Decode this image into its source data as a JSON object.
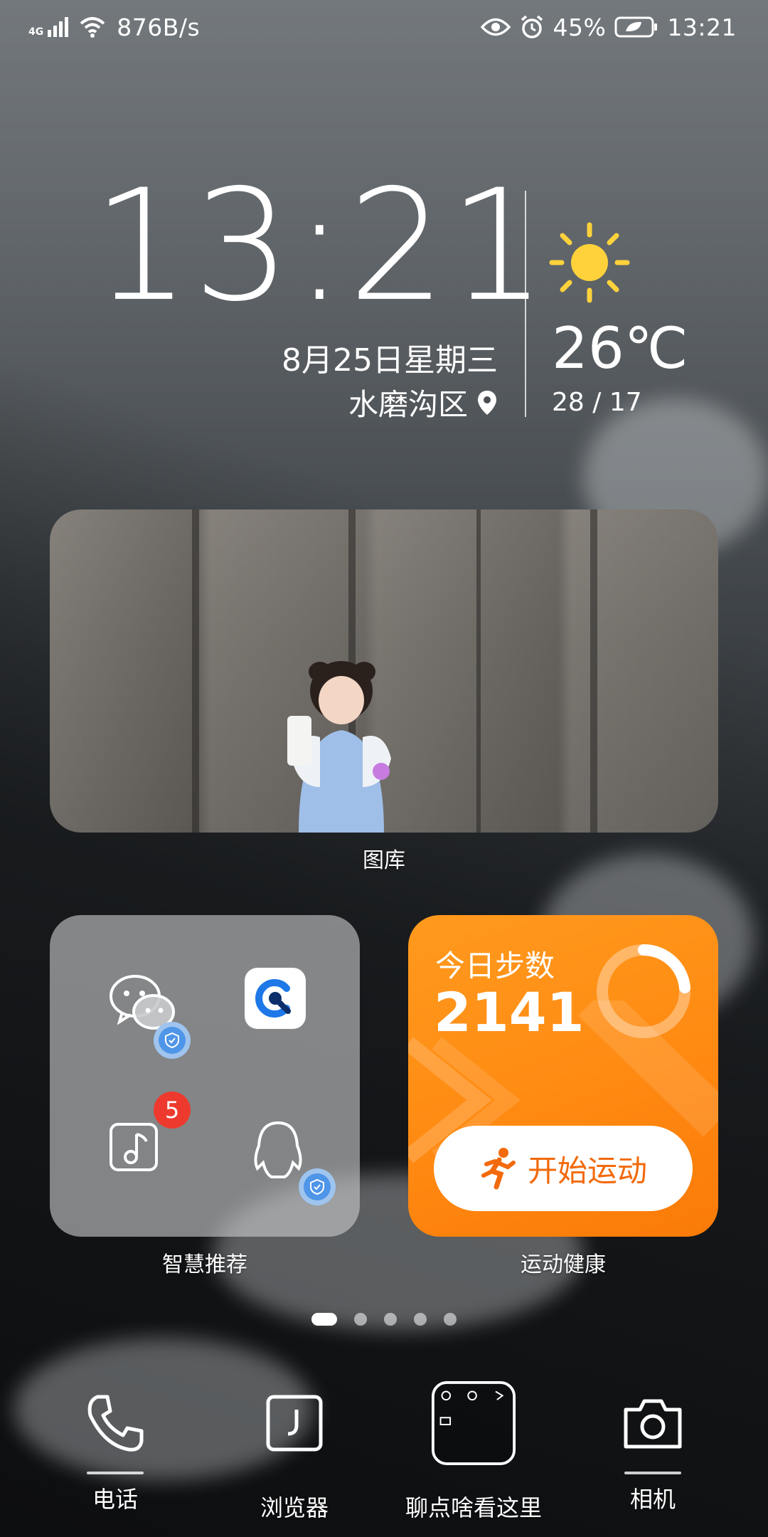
{
  "status_bar": {
    "network_type": "4G",
    "net_speed": "876B/s",
    "battery": "45%",
    "time": "13:21"
  },
  "clock_widget": {
    "time": "13:21",
    "date": "8月25日星期三",
    "location": "水磨沟区",
    "temperature": "26℃",
    "temp_range": "28 / 17"
  },
  "photo_widget": {
    "label": "图库"
  },
  "smart_widget": {
    "label": "智慧推荐",
    "apps": [
      {
        "name": "wechat-icon",
        "verified": true
      },
      {
        "name": "browser-c-icon",
        "verified": false
      },
      {
        "name": "music-icon",
        "badge": "5"
      },
      {
        "name": "qq-icon",
        "verified": true
      }
    ]
  },
  "health_widget": {
    "label": "运动健康",
    "title": "今日步数",
    "steps": "2141",
    "button": "开始运动",
    "accent": "#ff8a12"
  },
  "pager": {
    "count": 5,
    "active": 0
  },
  "dock": [
    {
      "label": "电话",
      "icon": "phone-icon"
    },
    {
      "label": "浏览器",
      "icon": "browser-icon"
    },
    {
      "label": "聊点啥看这里",
      "icon": "folder-icon"
    },
    {
      "label": "相机",
      "icon": "camera-icon"
    }
  ]
}
